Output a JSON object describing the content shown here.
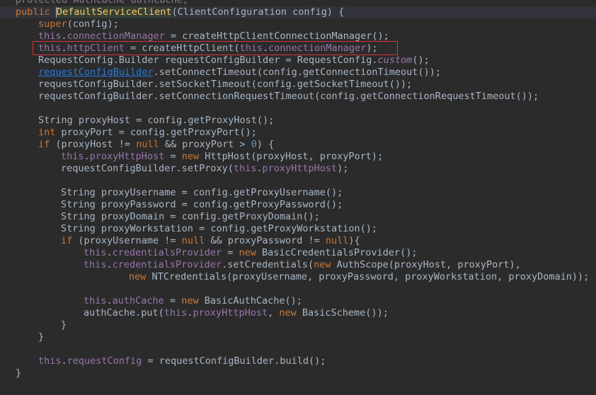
{
  "colors": {
    "background": "#2b2b2b",
    "keyword": "#cc7832",
    "field": "#9876aa",
    "method": "#ffc66d",
    "number": "#6897bb",
    "text": "#a9b7c6",
    "link": "#287bde",
    "highlight_border": "#d9323a"
  },
  "editor": {
    "highlighted_line": 2,
    "lines": [
      {
        "indent": 4,
        "tokens": [
          [
            "dim",
            "protected AuthCache authCache;"
          ]
        ]
      },
      {
        "indent": 4,
        "tokens": [
          [
            "kw",
            "public "
          ],
          [
            "declhl",
            "DefaultServiceClient"
          ],
          [
            "plain",
            "(ClientConfiguration config) {"
          ]
        ]
      },
      {
        "indent": 8,
        "tokens": [
          [
            "kw",
            "super"
          ],
          [
            "plain",
            "(config);"
          ]
        ]
      },
      {
        "indent": 8,
        "tokens": [
          [
            "this",
            "this"
          ],
          [
            "plain",
            "."
          ],
          [
            "field",
            "connectionManager"
          ],
          [
            "plain",
            " = createHttpClientConnectionManager();"
          ]
        ]
      },
      {
        "indent": 8,
        "tokens": [
          [
            "this",
            "this"
          ],
          [
            "plain",
            "."
          ],
          [
            "field",
            "httpClient"
          ],
          [
            "plain",
            " = createHttpClient("
          ],
          [
            "this",
            "this"
          ],
          [
            "plain",
            "."
          ],
          [
            "field",
            "connectionManager"
          ],
          [
            "plain",
            ");"
          ]
        ]
      },
      {
        "indent": 8,
        "tokens": [
          [
            "plain",
            "RequestConfig.Builder "
          ],
          [
            "var",
            "requestConfigBuilder"
          ],
          [
            "plain",
            " = RequestConfig."
          ],
          [
            "static",
            "custom"
          ],
          [
            "plain",
            "();"
          ]
        ]
      },
      {
        "indent": 8,
        "tokens": [
          [
            "link",
            "requestConfigBuilder"
          ],
          [
            "plain",
            ".setConnectTimeout(config.getConnectionTimeout());"
          ]
        ]
      },
      {
        "indent": 8,
        "tokens": [
          [
            "plain",
            "requestConfigBuilder.setSocketTimeout(config.getSocketTimeout());"
          ]
        ]
      },
      {
        "indent": 8,
        "tokens": [
          [
            "plain",
            "requestConfigBuilder.setConnectionRequestTimeout(config.getConnectionRequestTimeout());"
          ]
        ]
      },
      {
        "indent": 0,
        "tokens": []
      },
      {
        "indent": 8,
        "tokens": [
          [
            "plain",
            "String proxyHost = config.getProxyHost();"
          ]
        ]
      },
      {
        "indent": 8,
        "tokens": [
          [
            "kw",
            "int "
          ],
          [
            "plain",
            "proxyPort = config.getProxyPort();"
          ]
        ]
      },
      {
        "indent": 8,
        "tokens": [
          [
            "kw",
            "if "
          ],
          [
            "plain",
            "(proxyHost != "
          ],
          [
            "kw",
            "null "
          ],
          [
            "plain",
            "&& proxyPort > "
          ],
          [
            "num",
            "0"
          ],
          [
            "plain",
            ") {"
          ]
        ]
      },
      {
        "indent": 12,
        "tokens": [
          [
            "this",
            "this"
          ],
          [
            "plain",
            "."
          ],
          [
            "field",
            "proxyHttpHost"
          ],
          [
            "plain",
            " = "
          ],
          [
            "kw",
            "new "
          ],
          [
            "plain",
            "HttpHost(proxyHost, proxyPort);"
          ]
        ]
      },
      {
        "indent": 12,
        "tokens": [
          [
            "plain",
            "requestConfigBuilder.setProxy("
          ],
          [
            "this",
            "this"
          ],
          [
            "plain",
            "."
          ],
          [
            "field",
            "proxyHttpHost"
          ],
          [
            "plain",
            ");"
          ]
        ]
      },
      {
        "indent": 0,
        "tokens": []
      },
      {
        "indent": 12,
        "tokens": [
          [
            "plain",
            "String proxyUsername = config.getProxyUsername();"
          ]
        ]
      },
      {
        "indent": 12,
        "tokens": [
          [
            "plain",
            "String proxyPassword = config.getProxyPassword();"
          ]
        ]
      },
      {
        "indent": 12,
        "tokens": [
          [
            "plain",
            "String proxyDomain = config.getProxyDomain();"
          ]
        ]
      },
      {
        "indent": 12,
        "tokens": [
          [
            "plain",
            "String proxyWorkstation = config.getProxyWorkstation();"
          ]
        ]
      },
      {
        "indent": 12,
        "tokens": [
          [
            "kw",
            "if "
          ],
          [
            "plain",
            "(proxyUsername != "
          ],
          [
            "kw",
            "null "
          ],
          [
            "plain",
            "&& proxyPassword != "
          ],
          [
            "kw",
            "null"
          ],
          [
            "plain",
            "){"
          ]
        ]
      },
      {
        "indent": 16,
        "tokens": [
          [
            "this",
            "this"
          ],
          [
            "plain",
            "."
          ],
          [
            "field",
            "credentialsProvider"
          ],
          [
            "plain",
            " = "
          ],
          [
            "kw",
            "new "
          ],
          [
            "plain",
            "BasicCredentialsProvider();"
          ]
        ]
      },
      {
        "indent": 16,
        "tokens": [
          [
            "this",
            "this"
          ],
          [
            "plain",
            "."
          ],
          [
            "field",
            "credentialsProvider"
          ],
          [
            "plain",
            ".setCredentials("
          ],
          [
            "kw",
            "new "
          ],
          [
            "plain",
            "AuthScope(proxyHost, proxyPort),"
          ]
        ]
      },
      {
        "indent": 24,
        "tokens": [
          [
            "kw",
            "new "
          ],
          [
            "plain",
            "NTCredentials(proxyUsername, proxyPassword, proxyWorkstation, proxyDomain));"
          ]
        ]
      },
      {
        "indent": 0,
        "tokens": []
      },
      {
        "indent": 16,
        "tokens": [
          [
            "this",
            "this"
          ],
          [
            "plain",
            "."
          ],
          [
            "field",
            "authCache"
          ],
          [
            "plain",
            " = "
          ],
          [
            "kw",
            "new "
          ],
          [
            "plain",
            "BasicAuthCache();"
          ]
        ]
      },
      {
        "indent": 16,
        "tokens": [
          [
            "plain",
            "authCache.put("
          ],
          [
            "this",
            "this"
          ],
          [
            "plain",
            "."
          ],
          [
            "field",
            "proxyHttpHost"
          ],
          [
            "plain",
            ", "
          ],
          [
            "kw",
            "new "
          ],
          [
            "plain",
            "BasicScheme());"
          ]
        ]
      },
      {
        "indent": 12,
        "tokens": [
          [
            "plain",
            "}"
          ]
        ]
      },
      {
        "indent": 8,
        "tokens": [
          [
            "plain",
            "}"
          ]
        ]
      },
      {
        "indent": 0,
        "tokens": []
      },
      {
        "indent": 8,
        "tokens": [
          [
            "this",
            "this"
          ],
          [
            "plain",
            "."
          ],
          [
            "field",
            "requestConfig"
          ],
          [
            "plain",
            " = requestConfigBuilder.build();"
          ]
        ]
      },
      {
        "indent": 4,
        "tokens": [
          [
            "plain",
            "}"
          ]
        ]
      }
    ]
  }
}
